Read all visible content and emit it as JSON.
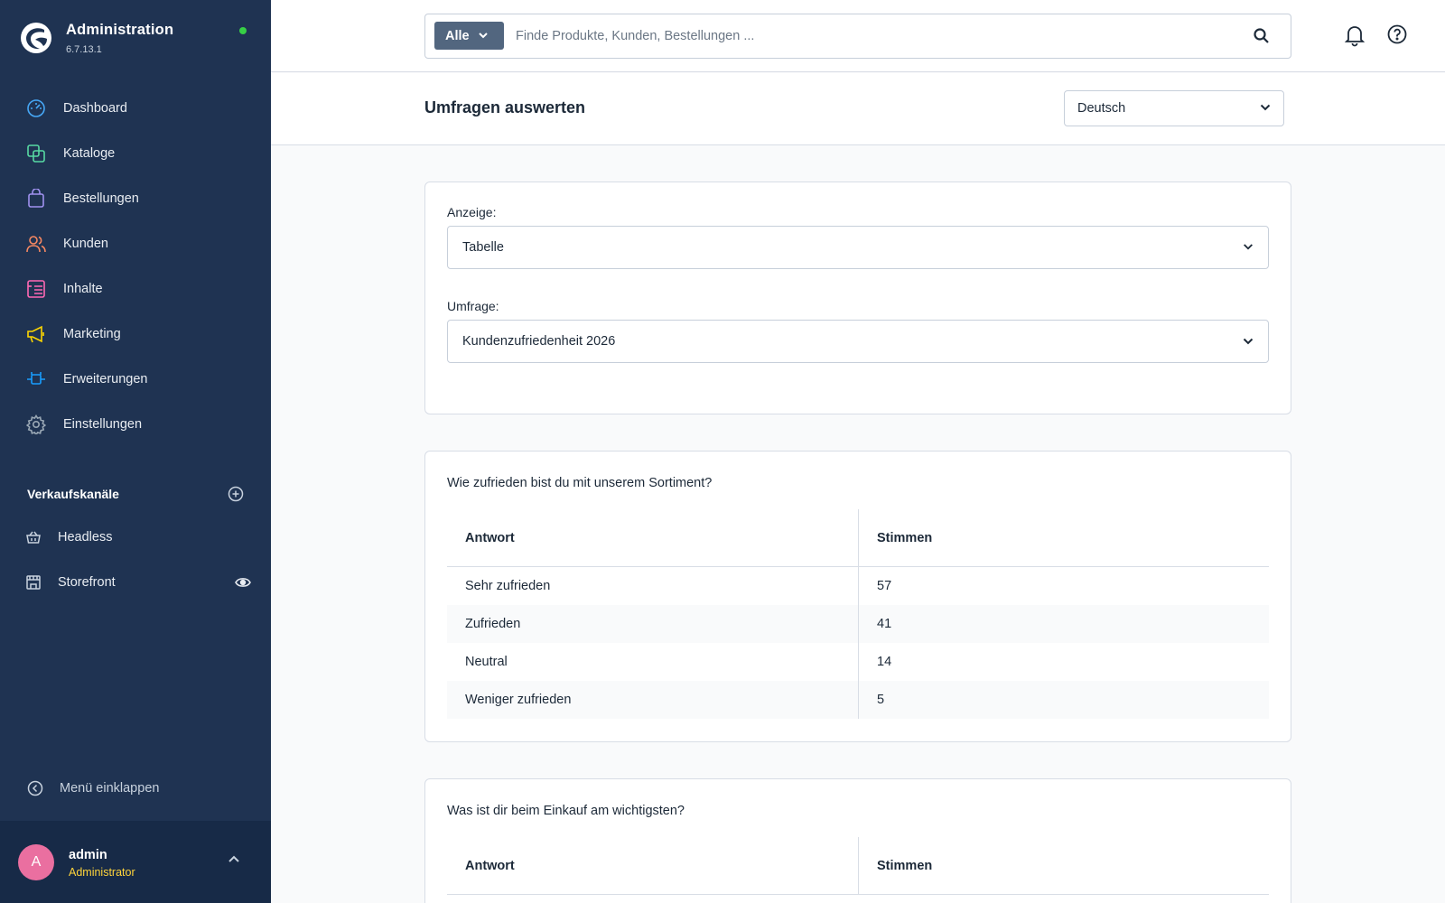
{
  "app": {
    "title": "Administration",
    "version": "6.7.13.1"
  },
  "nav": {
    "items": [
      {
        "label": "Dashboard",
        "icon": "dashboard-icon",
        "color": "#46a7f5"
      },
      {
        "label": "Kataloge",
        "icon": "catalog-icon",
        "color": "#57d9a3"
      },
      {
        "label": "Bestellungen",
        "icon": "orders-icon",
        "color": "#a092f0"
      },
      {
        "label": "Kunden",
        "icon": "customers-icon",
        "color": "#f88962"
      },
      {
        "label": "Inhalte",
        "icon": "content-icon",
        "color": "#ff68b4"
      },
      {
        "label": "Marketing",
        "icon": "marketing-icon",
        "color": "#ffd700"
      },
      {
        "label": "Erweiterungen",
        "icon": "extensions-icon",
        "color": "#189eff"
      },
      {
        "label": "Einstellungen",
        "icon": "settings-icon",
        "color": "#9aa8b5"
      }
    ]
  },
  "channels": {
    "title": "Verkaufskanäle",
    "items": [
      {
        "label": "Headless",
        "icon": "basket-icon"
      },
      {
        "label": "Storefront",
        "icon": "storefront-icon"
      }
    ]
  },
  "sidebar_footer": {
    "collapse_label": "Menü einklappen"
  },
  "user": {
    "initial": "A",
    "name": "admin",
    "role": "Administrator"
  },
  "search": {
    "type_label": "Alle",
    "placeholder": "Finde Produkte, Kunden, Bestellungen ..."
  },
  "page": {
    "title": "Umfragen auswerten",
    "language": "Deutsch"
  },
  "filters": {
    "display_label": "Anzeige:",
    "display_value": "Tabelle",
    "survey_label": "Umfrage:",
    "survey_value": "Kundenzufriedenheit 2026"
  },
  "results": [
    {
      "question": "Wie zufrieden bist du mit unserem Sortiment?",
      "col_answer": "Antwort",
      "col_votes": "Stimmen",
      "rows": [
        {
          "answer": "Sehr zufrieden",
          "votes": "57"
        },
        {
          "answer": "Zufrieden",
          "votes": "41"
        },
        {
          "answer": "Neutral",
          "votes": "14"
        },
        {
          "answer": "Weniger zufrieden",
          "votes": "5"
        }
      ]
    },
    {
      "question": "Was ist dir beim Einkauf am wichtigsten?",
      "col_answer": "Antwort",
      "col_votes": "Stimmen",
      "rows": []
    }
  ],
  "colors": {
    "sidebar": "#1f3352",
    "status_online": "#37d046",
    "avatar": "#ea6fa0",
    "role": "#ffd43b"
  }
}
